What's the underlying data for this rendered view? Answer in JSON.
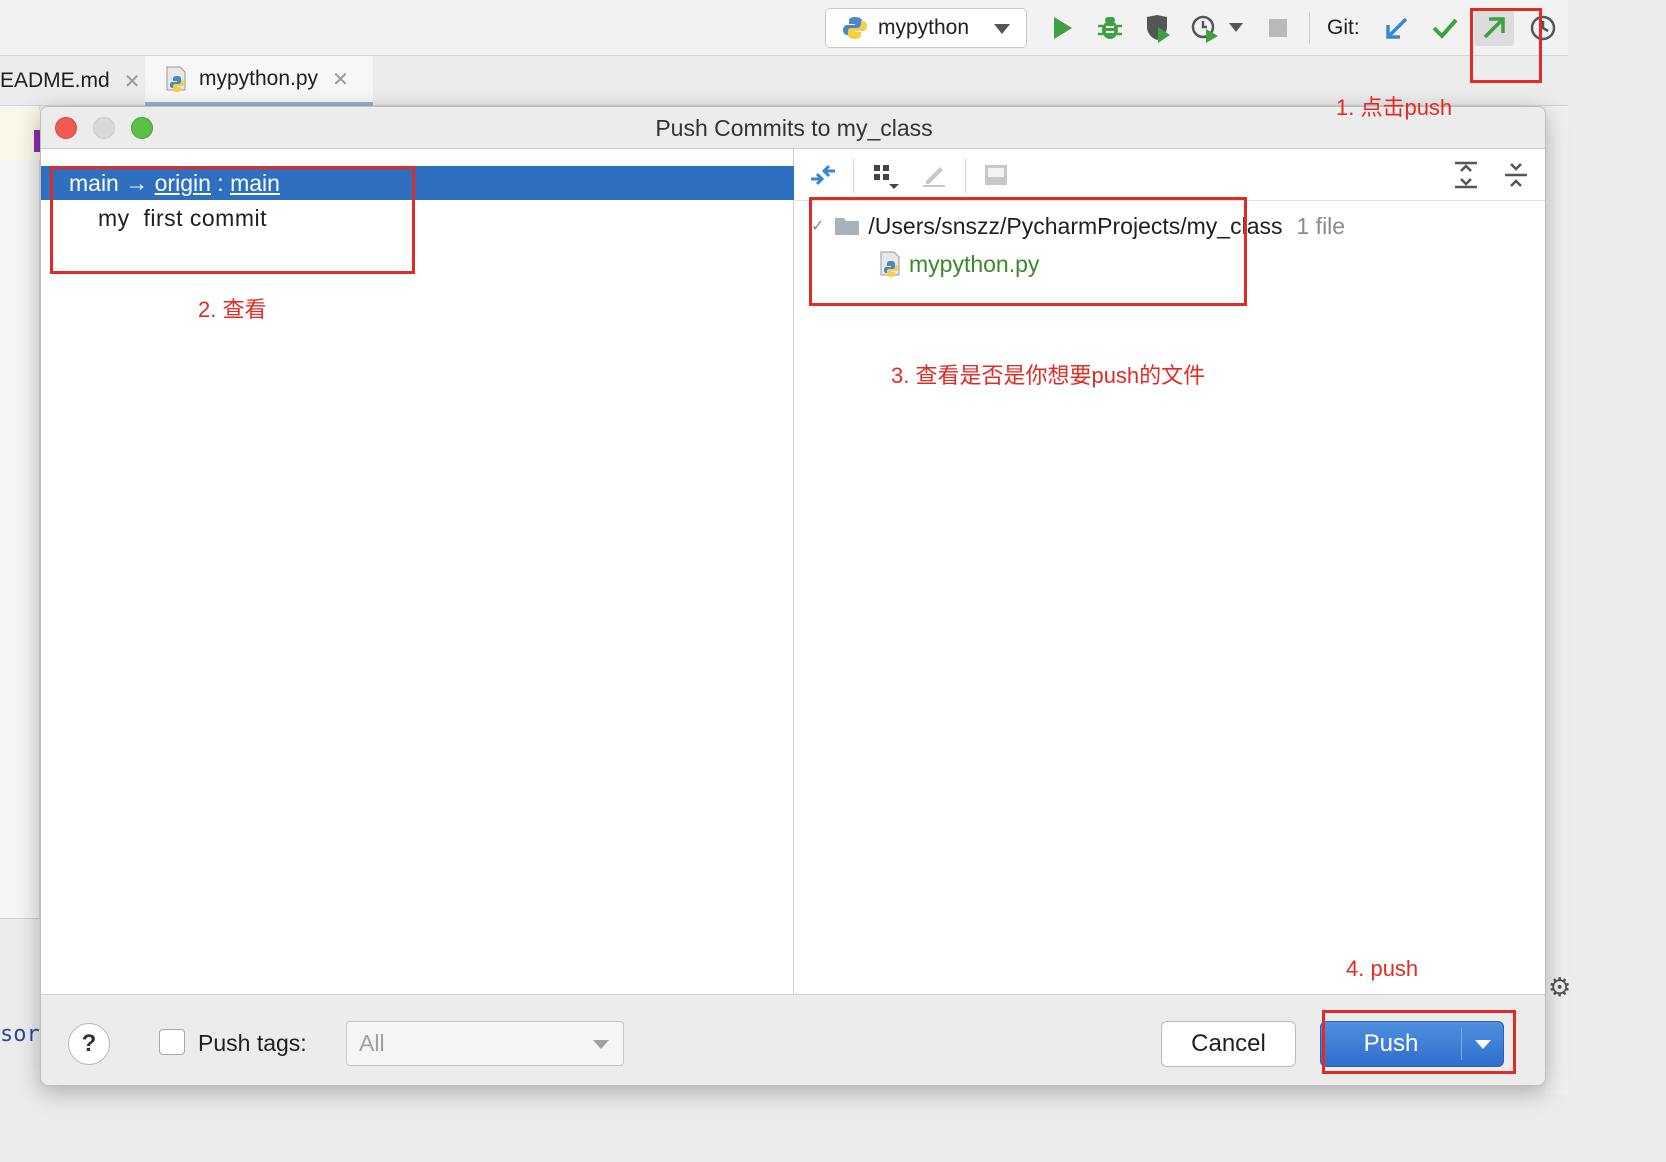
{
  "toolbar": {
    "run_config": "mypython",
    "git_label": "Git:"
  },
  "tabs": [
    {
      "label": "EADME.md"
    },
    {
      "label": "mypython.py"
    }
  ],
  "background": {
    "sort_text": "sort"
  },
  "dialog": {
    "title": "Push Commits to my_class",
    "branch": {
      "local": "main",
      "arrow": "→",
      "remote": "origin",
      "separator": ":",
      "remote_branch": "main"
    },
    "commit_message": "my  first commit",
    "tree": {
      "root_path": "/Users/snszz/PycharmProjects/my_class",
      "file_count": "1 file",
      "file": "mypython.py"
    },
    "footer": {
      "help": "?",
      "push_tags_label": "Push tags:",
      "push_tags_value": "All",
      "cancel": "Cancel",
      "push": "Push"
    }
  },
  "annotations": {
    "step1": "1. 点击push",
    "step2": "2. 查看",
    "step3": "3. 查看是否是你想要push的文件",
    "step4": "4. push"
  },
  "colors": {
    "accent": "#2f6fc0",
    "annotation": "#e02b26",
    "file_added": "#3a8a2a"
  }
}
